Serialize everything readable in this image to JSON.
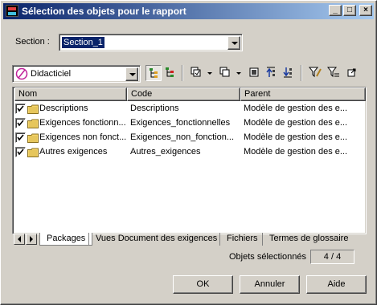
{
  "window": {
    "title": "Sélection des objets pour le rapport",
    "controls": {
      "minimize": "_",
      "maximize": "□",
      "close": "×"
    }
  },
  "section": {
    "label": "Section :",
    "value": "Section_1"
  },
  "toolbar": {
    "model_value": "Didacticiel",
    "tools": [
      {
        "name": "include-subpackages-icon"
      },
      {
        "name": "include-composite-icon"
      },
      {
        "name": "select-all-icon"
      },
      {
        "name": "deselect-all-icon"
      },
      {
        "name": "filter-selection-icon"
      },
      {
        "name": "move-to-top-icon"
      },
      {
        "name": "move-to-bottom-icon"
      },
      {
        "name": "define-filter-icon"
      },
      {
        "name": "filter-icon"
      },
      {
        "name": "restore-icon"
      }
    ]
  },
  "table": {
    "columns": [
      "Nom",
      "Code",
      "Parent"
    ],
    "rows": [
      {
        "checked": true,
        "name": "Descriptions",
        "code": "Descriptions",
        "parent": "Modèle de gestion des e..."
      },
      {
        "checked": true,
        "name": "Exigences fonctionn...",
        "code": "Exigences_fonctionnelles",
        "parent": "Modèle de gestion des e..."
      },
      {
        "checked": true,
        "name": "Exigences non fonct...",
        "code": "Exigences_non_fonction...",
        "parent": "Modèle de gestion des e..."
      },
      {
        "checked": true,
        "name": "Autres exigences",
        "code": "Autres_exigences",
        "parent": "Modèle de gestion des e..."
      }
    ]
  },
  "tabs": [
    {
      "label": "Packages",
      "active": true
    },
    {
      "label": "Vues Document des exigences",
      "active": false
    },
    {
      "label": "Fichiers",
      "active": false
    },
    {
      "label": "Termes de glossaire",
      "active": false
    }
  ],
  "status": {
    "label": "Objets sélectionnés",
    "value": "4 / 4"
  },
  "buttons": {
    "ok": "OK",
    "cancel": "Annuler",
    "help": "Aide"
  },
  "colors": {
    "title_start": "#0a246a",
    "title_end": "#a6caf0",
    "selection": "#0a246a",
    "face": "#d4d0c8",
    "folder": "#f6d56a"
  }
}
